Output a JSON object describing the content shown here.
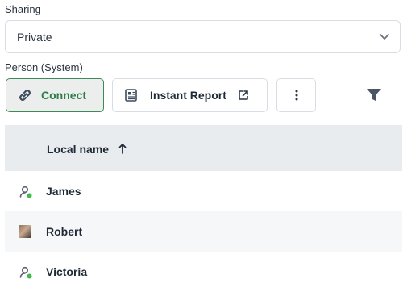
{
  "sharing": {
    "label": "Sharing",
    "selected": "Private"
  },
  "person": {
    "label": "Person (System)"
  },
  "toolbar": {
    "connect_label": "Connect",
    "instant_report_label": "Instant Report"
  },
  "table": {
    "columns": [
      "Local name"
    ],
    "sort": "ascending",
    "rows": [
      {
        "name": "James",
        "avatar": "person-icon"
      },
      {
        "name": "Robert",
        "avatar": "photo"
      },
      {
        "name": "Victoria",
        "avatar": "person-icon"
      }
    ]
  },
  "colors": {
    "accent": "#2e7d4a",
    "status_online": "#3fb950",
    "header_bg": "#e9ecef"
  }
}
